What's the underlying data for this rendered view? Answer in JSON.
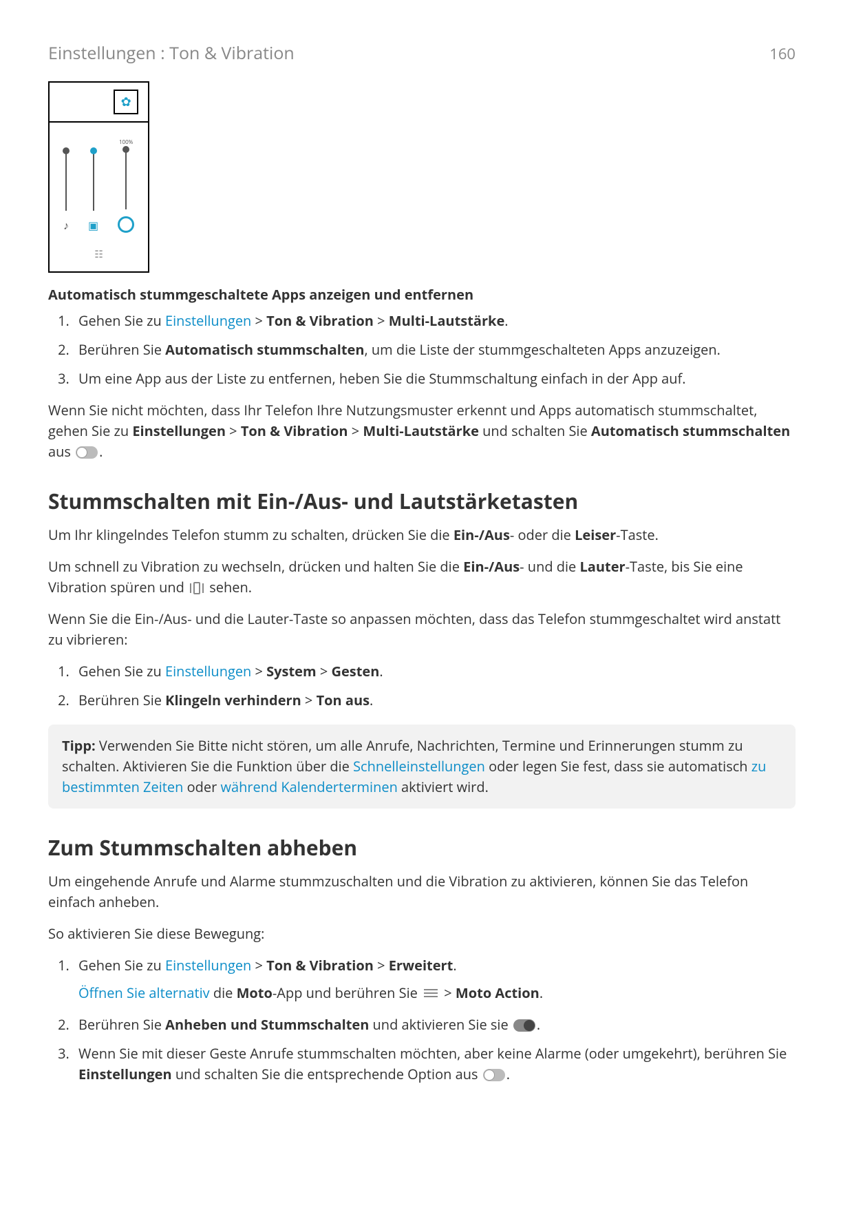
{
  "header": {
    "breadcrumb": "Einstellungen : Ton & Vibration",
    "page_number": "160"
  },
  "figure": {
    "slider_label": "100%"
  },
  "section_auto": {
    "heading": "Automatisch stummgeschaltete Apps anzeigen und entfernen",
    "step1_a": "Gehen Sie zu ",
    "step1_link": "Einstellungen",
    "step1_b": " > ",
    "step1_bold1": "Ton & Vibration",
    "step1_c": " > ",
    "step1_bold2": "Multi-Lautstärke",
    "step1_d": ".",
    "step2_a": "Berühren Sie ",
    "step2_bold": "Automatisch stummschalten",
    "step2_b": ", um die Liste der stummgeschalteten Apps anzuzeigen.",
    "step3": "Um eine App aus der Liste zu entfernen, heben Sie die Stummschaltung einfach in der App auf.",
    "para_a": "Wenn Sie nicht möchten, dass Ihr Telefon Ihre Nutzungsmuster erkennt und Apps automatisch stummschaltet, gehen Sie zu ",
    "para_b1": "Einstellungen",
    "para_c": " > ",
    "para_b2": "Ton & Vibration",
    "para_d": " > ",
    "para_b3": "Multi-Lautstärke",
    "para_e": " und schalten Sie ",
    "para_b4": "Automatisch stummschalten",
    "para_f": " aus ",
    "para_g": "."
  },
  "section_mute": {
    "heading": "Stummschalten mit Ein-/Aus- und Lautstärketasten",
    "p1_a": "Um Ihr klingelndes Telefon stumm zu schalten, drücken Sie die ",
    "p1_b1": "Ein-/Aus",
    "p1_b": "- oder die ",
    "p1_b2": "Leiser",
    "p1_c": "-Taste.",
    "p2_a": "Um schnell zu Vibration zu wechseln, drücken und halten Sie die ",
    "p2_b1": "Ein-/Aus",
    "p2_b": "- und die ",
    "p2_b2": "Lauter",
    "p2_c": "-Taste, bis Sie eine Vibration spüren und ",
    "p2_d": " sehen.",
    "p3": "Wenn Sie die Ein-/Aus- und die Lauter-Taste so anpassen möchten, dass das Telefon stummgeschaltet wird anstatt zu vibrieren:",
    "step1_a": "Gehen Sie zu ",
    "step1_link": "Einstellungen",
    "step1_b": " > ",
    "step1_bold1": "System",
    "step1_c": " > ",
    "step1_bold2": "Gesten",
    "step1_d": ".",
    "step2_a": "Berühren Sie ",
    "step2_bold1": "Klingeln verhindern",
    "step2_b": " > ",
    "step2_bold2": "Ton aus",
    "step2_c": "."
  },
  "tip": {
    "label": "Tipp:",
    "a": " Verwenden Sie Bitte nicht stören, um alle Anrufe, Nachrichten, Termine und Erinnerungen stumm zu schalten. Aktivieren Sie die Funktion über die ",
    "link1": "Schnelleinstellungen",
    "b": " oder legen Sie fest, dass sie automatisch ",
    "link2": "zu bestimmten Zeiten",
    "c": " oder ",
    "link3": "während Kalenderterminen",
    "d": " aktiviert wird."
  },
  "section_pickup": {
    "heading": "Zum Stummschalten abheben",
    "p1": "Um eingehende Anrufe und Alarme stummzuschalten und die Vibration zu aktivieren, können Sie das Telefon einfach anheben.",
    "p2": "So aktivieren Sie diese Bewegung:",
    "step1_a": "Gehen Sie zu ",
    "step1_link": "Einstellungen",
    "step1_b": " > ",
    "step1_bold1": "Ton & Vibration",
    "step1_c": " > ",
    "step1_bold2": "Erweitert",
    "step1_d": ".",
    "step1_sub_link": "Öffnen Sie alternativ",
    "step1_sub_a": " die ",
    "step1_sub_bold1": "Moto",
    "step1_sub_b": "-App und berühren Sie ",
    "step1_sub_c": " > ",
    "step1_sub_bold2": "Moto Action",
    "step1_sub_d": ".",
    "step2_a": "Berühren Sie ",
    "step2_bold": "Anheben und Stummschalten",
    "step2_b": " und aktivieren Sie sie ",
    "step2_c": ".",
    "step3_a": "Wenn Sie mit dieser Geste Anrufe stummschalten möchten, aber keine Alarme (oder umgekehrt), berühren Sie ",
    "step3_bold": "Einstellungen",
    "step3_b": " und schalten Sie die entsprechende Option aus ",
    "step3_c": "."
  }
}
